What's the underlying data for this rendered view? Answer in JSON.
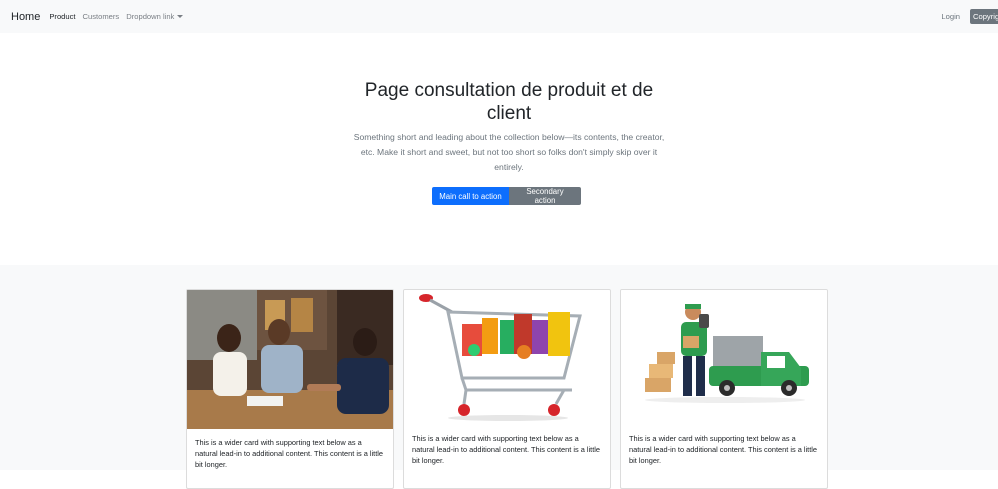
{
  "navbar": {
    "brand": "Home",
    "links": [
      {
        "label": "Product"
      },
      {
        "label": "Customers"
      },
      {
        "label": "Dropdown link"
      }
    ],
    "login": "Login",
    "copy_button": "Copyright"
  },
  "hero": {
    "title": "Page consultation de produit et de client",
    "lead": "Something short and leading about the collection below—its contents, the creator, etc. Make it short and sweet, but not too short so folks don't simply skip over it entirely.",
    "primary_action": "Main call to action",
    "secondary_action": "Secondary action"
  },
  "cards": [
    {
      "text": "This is a wider card with supporting text below as a natural lead-in to additional content. This content is a little bit longer."
    },
    {
      "text": "This is a wider card with supporting text below as a natural lead-in to additional content. This content is a little bit longer."
    },
    {
      "text": "This is a wider card with supporting text below as a natural lead-in to additional content. This content is a little bit longer."
    }
  ]
}
